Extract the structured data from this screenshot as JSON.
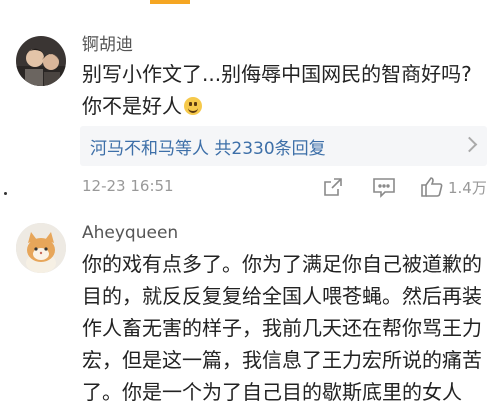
{
  "comments": [
    {
      "username": "锕胡迪",
      "text": "别写小作文了...别侮辱中国网民的智商好吗? 你不是好人",
      "emoji": "smile-emoji",
      "replies_user": "河马不和马等人",
      "replies_count": "共2330条回复",
      "timestamp": "12-23 16:51",
      "likes": "1.4万"
    },
    {
      "username": "Aheyqueen",
      "text": "你的戏有点多了。你为了满足你自己被道歉的目的，就反反复复给全国人喂苍蝇。然后再装作人畜无害的样子，我前几天还在帮你骂王力宏，但是这一篇，我信息了王力宏所说的痛苦了。你是一个为了自己目的歇斯底里的女人"
    }
  ],
  "icons": {
    "share": "share-icon",
    "reply": "comment-icon",
    "like": "thumbs-up-icon"
  },
  "colors": {
    "link": "#3d6fa8",
    "accent": "#f5a623"
  }
}
